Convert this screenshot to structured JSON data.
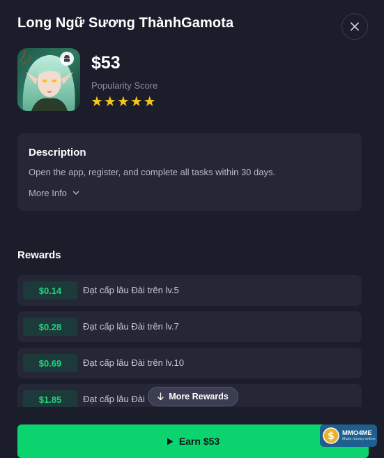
{
  "header": {
    "title": "Long Ngữ Sương ThànhGamota",
    "close_icon": "close-icon"
  },
  "app": {
    "price": "$53",
    "popularity_label": "Popularity Score",
    "stars": "★★★★★",
    "rating": 5,
    "platform_icon": "android-icon"
  },
  "description": {
    "heading": "Description",
    "text": "Open the app, register, and complete all tasks within 30 days.",
    "more_info_label": "More Info"
  },
  "rewards": {
    "heading": "Rewards",
    "items": [
      {
        "amount": "$0.14",
        "task": "Đạt cấp lâu Đài trên lv.5"
      },
      {
        "amount": "$0.28",
        "task": "Đạt cấp lâu Đài trên lv.7"
      },
      {
        "amount": "$0.69",
        "task": "Đạt cấp lâu Đài trên lv.10"
      },
      {
        "amount": "$1.85",
        "task": "Đạt cấp lâu Đài"
      }
    ],
    "more_rewards_label": "More Rewards"
  },
  "action": {
    "earn_label": "Earn $53"
  },
  "watermark": {
    "name": "MMO4ME",
    "tagline": "Make money online"
  },
  "colors": {
    "background": "#1c1d2b",
    "card": "#252737",
    "accent_green": "#0bd36e",
    "reward_green": "#1fd47c",
    "star_yellow": "#f5c518"
  }
}
